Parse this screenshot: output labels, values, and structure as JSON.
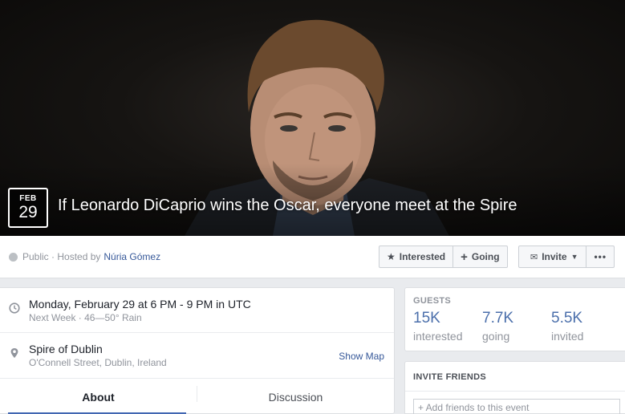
{
  "event": {
    "month": "FEB",
    "day": "29",
    "title": "If Leonardo DiCaprio wins the Oscar, everyone meet at the Spire"
  },
  "header": {
    "privacy": "Public · Hosted by",
    "host": "Núria Gómez"
  },
  "actions": {
    "interested": "Interested",
    "going": "Going",
    "invite": "Invite",
    "more": "•••"
  },
  "details": {
    "datetime": "Monday, February 29 at 6 PM - 9 PM in UTC",
    "weather": "Next Week · 46—50° Rain",
    "location_name": "Spire of Dublin",
    "location_address": "O'Connell Street, Dublin, Ireland",
    "show_map": "Show Map"
  },
  "tabs": [
    {
      "label": "About",
      "active": true
    },
    {
      "label": "Discussion",
      "active": false
    }
  ],
  "guests": {
    "heading": "GUESTS",
    "stats": [
      {
        "value": "15K",
        "label": "interested"
      },
      {
        "value": "7.7K",
        "label": "going"
      },
      {
        "value": "5.5K",
        "label": "invited"
      }
    ]
  },
  "invite_friends": {
    "heading": "INVITE FRIENDS",
    "placeholder": "+ Add friends to this event"
  },
  "colors": {
    "link": "#365899",
    "accent": "#4267b2",
    "stat": "#4b6fab"
  },
  "icons": [
    "globe-icon",
    "star-icon",
    "plus-icon",
    "envelope-icon",
    "caret-down-icon",
    "clock-icon",
    "map-pin-icon"
  ]
}
